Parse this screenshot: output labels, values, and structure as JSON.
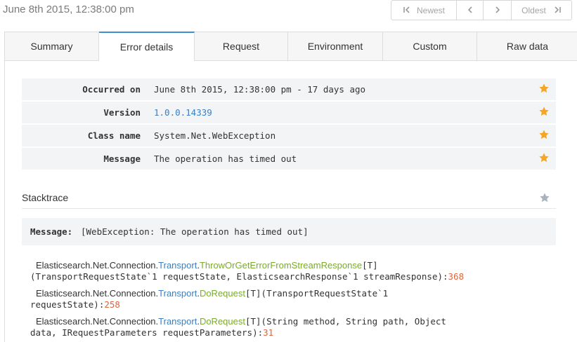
{
  "header": {
    "date": "June 8th 2015, 12:38:00 pm",
    "pager": {
      "newest": "Newest",
      "oldest": "Oldest"
    }
  },
  "tabs": [
    {
      "label": "Summary"
    },
    {
      "label": "Error details"
    },
    {
      "label": "Request"
    },
    {
      "label": "Environment"
    },
    {
      "label": "Custom"
    },
    {
      "label": "Raw data"
    }
  ],
  "details": [
    {
      "label": "Occurred on",
      "value": "June 8th 2015, 12:38:00 pm - 17 days ago"
    },
    {
      "label": "Version",
      "value": "1.0.0.14339"
    },
    {
      "label": "Class name",
      "value": "System.Net.WebException"
    },
    {
      "label": "Message",
      "value": "The operation has timed out"
    }
  ],
  "stacktrace": {
    "title": "Stacktrace",
    "message_label": "Message:",
    "message_value": "[WebException: The operation has timed out]",
    "frames": [
      {
        "ns": "Elasticsearch.Net.Connection.",
        "cls": "Transport",
        "dot": ".",
        "method": "ThrowOrGetErrorFromStreamResponse",
        "generic": "[T]",
        "args": "(TransportRequestState`1 requestState, ElasticsearchResponse`1 streamResponse):",
        "line": "368"
      },
      {
        "ns": "Elasticsearch.Net.Connection.",
        "cls": "Transport",
        "dot": ".",
        "method": "DoRequest",
        "generic": "[T](TransportRequestState`1",
        "args": "requestState):",
        "line": "258"
      },
      {
        "ns": "Elasticsearch.Net.Connection.",
        "cls": "Transport",
        "dot": ".",
        "method": "DoRequest",
        "generic": "[T](String method, String path, Object",
        "args": "data, IRequestParameters requestParameters):",
        "line": "31"
      }
    ]
  },
  "colors": {
    "accent": "#3c8fd0",
    "star_active": "#f5a623",
    "star_inactive": "#a9b2bd",
    "link": "#3a7fc4",
    "method": "#7bab2e",
    "line_number": "#e0643a"
  }
}
